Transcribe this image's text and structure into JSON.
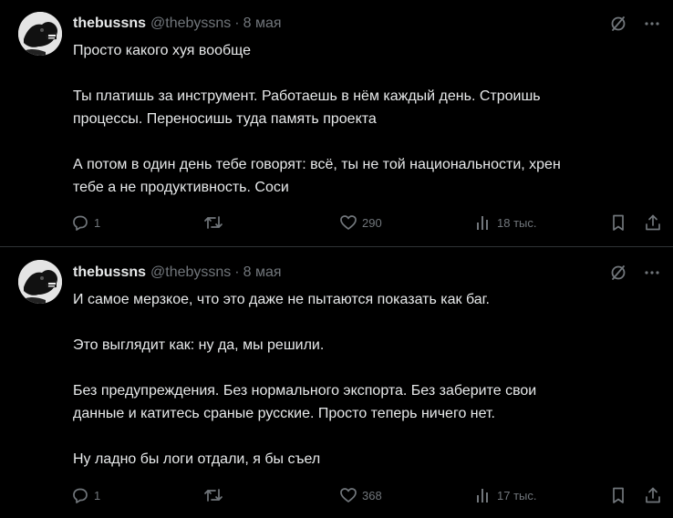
{
  "posts": [
    {
      "author": {
        "display_name": "thebussns",
        "handle": "@thebyssns",
        "separator": "·",
        "date": "8 мая",
        "avatar_icon": "dog-avatar-icon"
      },
      "paragraphs": [
        "Просто какого хуя вообще",
        "Ты платишь за инструмент. Работаешь в нём каждый день. Строишь\nпроцессы. Переносишь туда память проекта",
        "А потом в один день тебе говорят: всё, ты не той национальности, хрен\nтебе а не продуктивность. Соси"
      ],
      "stats": {
        "replies": "1",
        "reposts": "",
        "likes": "290",
        "views": "18 тыс."
      }
    },
    {
      "author": {
        "display_name": "thebussns",
        "handle": "@thebyssns",
        "separator": "·",
        "date": "8 мая",
        "avatar_icon": "dog-avatar-icon"
      },
      "paragraphs": [
        "И самое мерзкое, что это даже не пытаются показать как баг.",
        "Это выглядит как: ну да, мы решили.",
        "Без предупреждения. Без нормального экспорта. Без заберите свои\nданные и катитесь сраные русские. Просто теперь ничего нет.",
        "Ну ладно бы логи отдали, я бы съел"
      ],
      "stats": {
        "replies": "1",
        "reposts": "",
        "likes": "368",
        "views": "17 тыс."
      }
    }
  ],
  "icons": {
    "top_right": [
      "grok-slash-icon",
      "more-icon"
    ],
    "actions": [
      "reply-icon",
      "repost-icon",
      "like-icon",
      "views-icon",
      "bookmark-icon",
      "share-icon"
    ]
  },
  "colors": {
    "background": "#000000",
    "text": "#e7e9ea",
    "muted": "#71767b",
    "divider": "#2f3336"
  }
}
